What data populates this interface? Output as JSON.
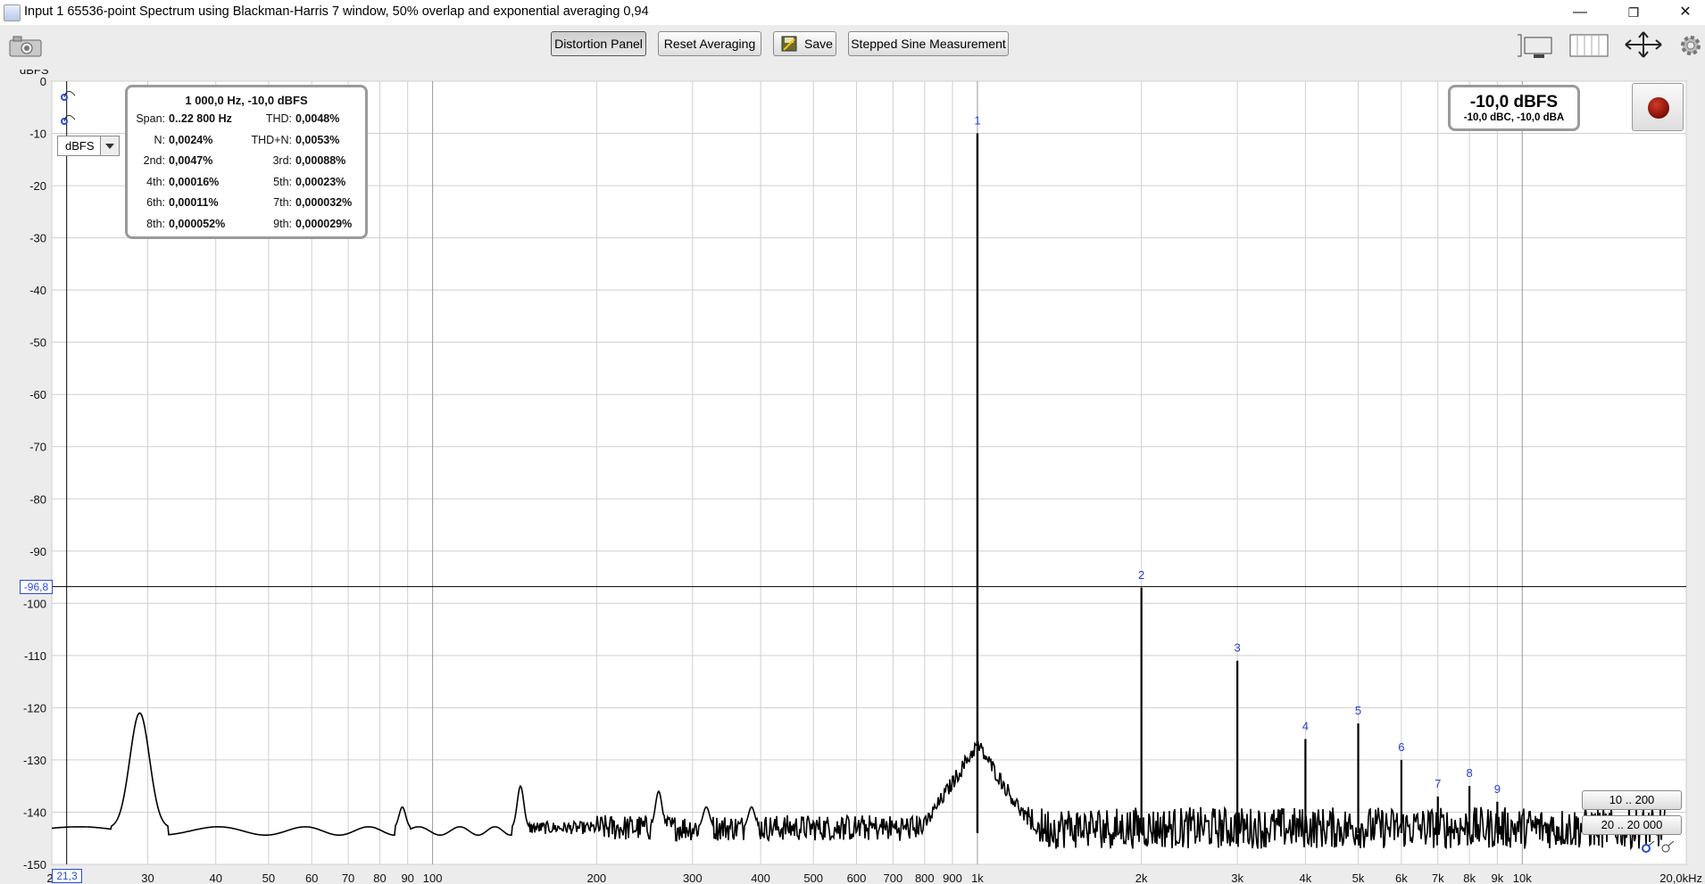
{
  "window": {
    "title": "Input 1 65536-point Spectrum using Blackman-Harris 7 window, 50% overlap and exponential averaging 0,94",
    "minimize": "—",
    "restore": "❐",
    "close": "✕"
  },
  "toolbar": {
    "distortion_panel": "Distortion Panel",
    "reset_averaging": "Reset Averaging",
    "save": "Save",
    "stepped_sine": "Stepped Sine Measurement"
  },
  "panel": {
    "header": "1 000,0 Hz, -10,0 dBFS",
    "rows": [
      {
        "k1": "Span:",
        "v1": "0..22 800 Hz",
        "k2": "THD:",
        "v2": "0,0048%"
      },
      {
        "k1": "N:",
        "v1": "0,0024%",
        "k2": "THD+N:",
        "v2": "0,0053%"
      },
      {
        "k1": "2nd:",
        "v1": "0,0047%",
        "k2": "3rd:",
        "v2": "0,00088%"
      },
      {
        "k1": "4th:",
        "v1": "0,00016%",
        "k2": "5th:",
        "v2": "0,00023%"
      },
      {
        "k1": "6th:",
        "v1": "0,00011%",
        "k2": "7th:",
        "v2": "0,000032%"
      },
      {
        "k1": "8th:",
        "v1": "0,000052%",
        "k2": "9th:",
        "v2": "0,000029%"
      }
    ]
  },
  "level": {
    "main": "-10,0 dBFS",
    "sub": "-10,0 dBC, -10,0 dBA"
  },
  "unit_select": "dBFS",
  "range_buttons": {
    "r1": "10 .. 200",
    "r2": "20 .. 20 000"
  },
  "cursor": {
    "y_value": "-96,8",
    "x_value": "21,3"
  },
  "chart_data": {
    "type": "line",
    "ylabel": "dBFS",
    "xlabel": "",
    "x_scale": "log",
    "ylim": [
      -150,
      0
    ],
    "xlim": [
      20,
      20000
    ],
    "yticks": [
      "0",
      "-10",
      "-20",
      "-30",
      "-40",
      "-50",
      "-60",
      "-70",
      "-80",
      "-90",
      "-100",
      "-110",
      "-120",
      "-130",
      "-140",
      "-150"
    ],
    "xticks": [
      {
        "v": 20,
        "label": "2"
      },
      {
        "v": 30,
        "label": "30"
      },
      {
        "v": 40,
        "label": "40"
      },
      {
        "v": 50,
        "label": "50"
      },
      {
        "v": 60,
        "label": "60"
      },
      {
        "v": 70,
        "label": "70"
      },
      {
        "v": 80,
        "label": "80"
      },
      {
        "v": 90,
        "label": "90"
      },
      {
        "v": 100,
        "label": "100"
      },
      {
        "v": 200,
        "label": "200"
      },
      {
        "v": 300,
        "label": "300"
      },
      {
        "v": 400,
        "label": "400"
      },
      {
        "v": 500,
        "label": "500"
      },
      {
        "v": 600,
        "label": "600"
      },
      {
        "v": 700,
        "label": "700"
      },
      {
        "v": 800,
        "label": "800"
      },
      {
        "v": 900,
        "label": "900"
      },
      {
        "v": 1000,
        "label": "1k"
      },
      {
        "v": 2000,
        "label": "2k"
      },
      {
        "v": 3000,
        "label": "3k"
      },
      {
        "v": 4000,
        "label": "4k"
      },
      {
        "v": 5000,
        "label": "5k"
      },
      {
        "v": 6000,
        "label": "6k"
      },
      {
        "v": 7000,
        "label": "7k"
      },
      {
        "v": 8000,
        "label": "8k"
      },
      {
        "v": 9000,
        "label": "9k"
      },
      {
        "v": 10000,
        "label": "10k"
      },
      {
        "v": 20000,
        "label": "20,0kHz"
      }
    ],
    "harmonics": [
      {
        "label": "1",
        "freq": 1000,
        "level": -10
      },
      {
        "label": "2",
        "freq": 2000,
        "level": -97
      },
      {
        "label": "3",
        "freq": 3000,
        "level": -111
      },
      {
        "label": "4",
        "freq": 4000,
        "level": -126
      },
      {
        "label": "5",
        "freq": 5000,
        "level": -123
      },
      {
        "label": "6",
        "freq": 6000,
        "level": -130
      },
      {
        "label": "7",
        "freq": 7000,
        "level": -137
      },
      {
        "label": "8",
        "freq": 8000,
        "level": -135
      },
      {
        "label": "9",
        "freq": 9000,
        "level": -138
      }
    ],
    "spurs": [
      {
        "freq": 29,
        "level": -121
      },
      {
        "freq": 88,
        "level": -139
      },
      {
        "freq": 145,
        "level": -135
      },
      {
        "freq": 260,
        "level": -136
      },
      {
        "freq": 318,
        "level": -139
      },
      {
        "freq": 385,
        "level": -139
      }
    ],
    "noise_floor": -143,
    "cursor_level": -96.8,
    "grid": true,
    "series_color": "#000000",
    "label_color": "#2a3fd0"
  }
}
